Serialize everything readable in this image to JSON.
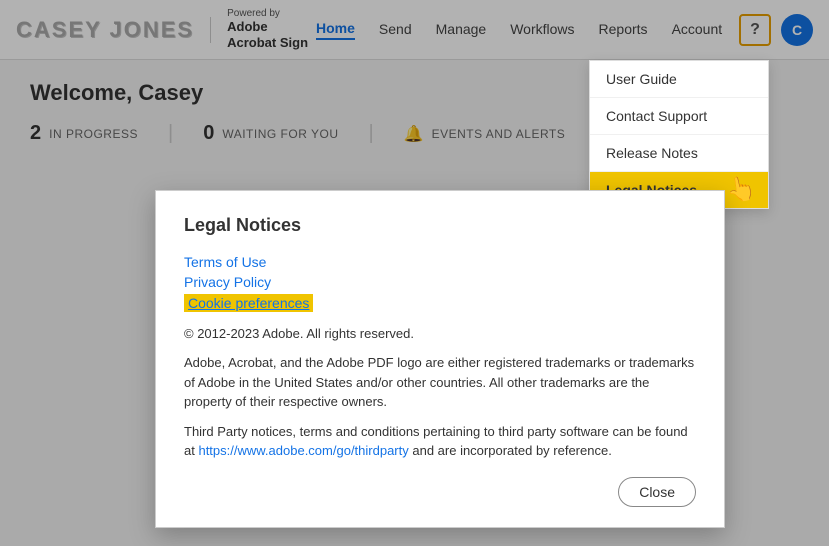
{
  "header": {
    "logo_text": "CASEY JONES",
    "powered_by": "Powered by",
    "product_line1": "Adobe",
    "product_line2": "Acrobat Sign",
    "nav_items": [
      {
        "label": "Home",
        "active": true
      },
      {
        "label": "Send",
        "active": false
      },
      {
        "label": "Manage",
        "active": false
      },
      {
        "label": "Workflows",
        "active": false
      },
      {
        "label": "Reports",
        "active": false
      },
      {
        "label": "Account",
        "active": false
      }
    ],
    "help_icon": "?",
    "avatar_text": "C"
  },
  "dropdown": {
    "items": [
      {
        "label": "User Guide",
        "active": false
      },
      {
        "label": "Contact Support",
        "active": false
      },
      {
        "label": "Release Notes",
        "active": false
      },
      {
        "label": "Legal Notices",
        "active": true
      }
    ]
  },
  "main": {
    "welcome": "Welcome, Casey",
    "stats": [
      {
        "number": "2",
        "label": "IN PROGRESS"
      },
      {
        "number": "0",
        "label": "WAITING FOR YOU"
      },
      {
        "label": "EVENTS AND ALERTS"
      }
    ]
  },
  "modal": {
    "title": "Legal Notices",
    "links": [
      {
        "label": "Terms of Use",
        "highlighted": false
      },
      {
        "label": "Privacy Policy",
        "highlighted": false
      },
      {
        "label": "Cookie preferences",
        "highlighted": true
      }
    ],
    "copyright": "© 2012-2023 Adobe. All rights reserved.",
    "body1": "Adobe, Acrobat, and the Adobe PDF logo are either registered trademarks or trademarks of Adobe in the United States and/or other countries. All other trademarks are the property of their respective owners.",
    "body2_prefix": "Third Party notices, terms and conditions pertaining to third party software can be found at ",
    "body2_link": "https://www.adobe.com/go/thirdparty",
    "body2_suffix": " and are incorporated by reference.",
    "close_button": "Close"
  }
}
